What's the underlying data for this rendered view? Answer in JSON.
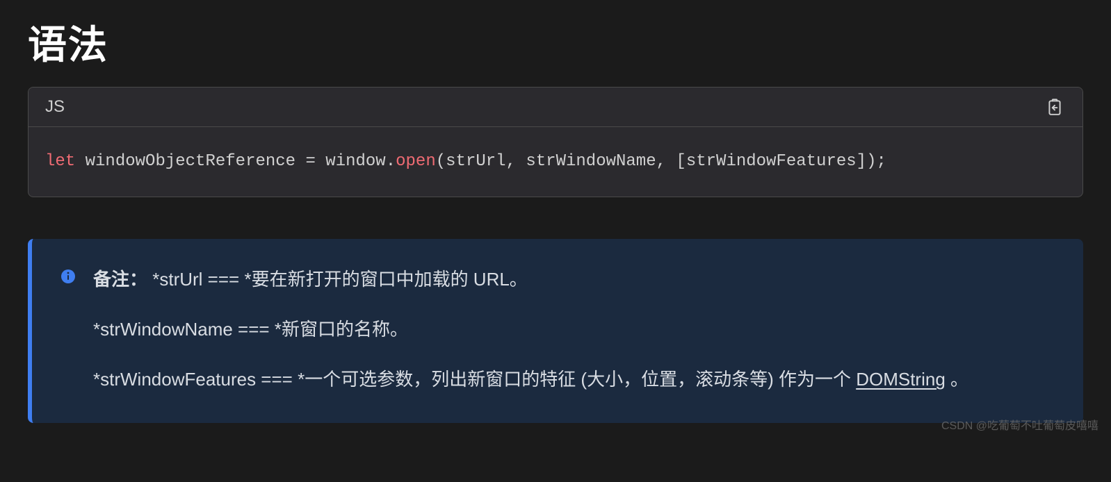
{
  "heading": "语法",
  "code": {
    "language": "JS",
    "tokens": {
      "kw_let": "let",
      "sp1": " ",
      "ident_ref": "windowObjectReference",
      "sp2": " ",
      "op_eq": "=",
      "sp3": " ",
      "ident_window": "window",
      "dot": ".",
      "method_open": "open",
      "lparen": "(",
      "arg1": "strUrl",
      "comma1": ",",
      "sp4": " ",
      "arg2": "strWindowName",
      "comma2": ",",
      "sp5": " ",
      "lbrack": "[",
      "arg3": "strWindowFeatures",
      "rbrack": "]",
      "rparen": ")",
      "semi": ";"
    }
  },
  "note": {
    "label": "备注：",
    "line1_rest": " *strUrl === *要在新打开的窗口中加载的 URL。",
    "line2": "*strWindowName === *新窗口的名称。",
    "line3_pre": "*strWindowFeatures === *一个可选参数，列出新窗口的特征 (大小，位置，滚动条等) 作为一个",
    "line3_link": "DOMString",
    "line3_post": "。"
  },
  "watermark": "CSDN @吃葡萄不吐葡萄皮嘻嘻"
}
